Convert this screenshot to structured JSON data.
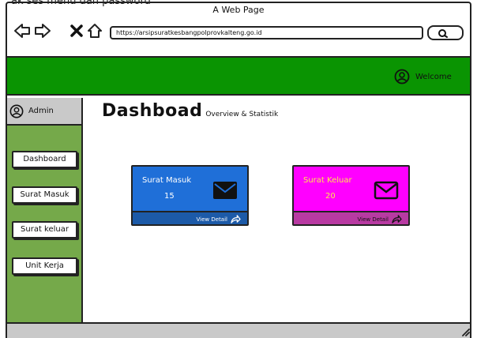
{
  "window": {
    "title": "A Web Page",
    "top_caption": "ak  ses menu dan password"
  },
  "address_bar": {
    "url": "https://arsipsuratkesbangpolprovkalteng.go.id"
  },
  "header": {
    "welcome_label": "Welcome",
    "user_icon": "user-circle-icon",
    "bar_color": "#0a9402"
  },
  "sidebar": {
    "admin_label": "Admin",
    "bg_color": "#75a94a",
    "items": [
      {
        "label": "Dashboard"
      },
      {
        "label": "Surat Masuk"
      },
      {
        "label": "Surat keluar"
      },
      {
        "label": "Unit Kerja"
      }
    ]
  },
  "main": {
    "title_initial": "D",
    "title_rest": "ashboad",
    "subtitle": "Overview & Statistik",
    "cards": [
      {
        "label": "Surat Masuk",
        "count": "15",
        "link": "View Detail",
        "color": "#1f6fd8",
        "icon": "mail-icon"
      },
      {
        "label": "Surat Keluar",
        "count": "20",
        "link": "View Detail",
        "color": "#ff00ff",
        "icon": "mail-icon"
      }
    ]
  }
}
